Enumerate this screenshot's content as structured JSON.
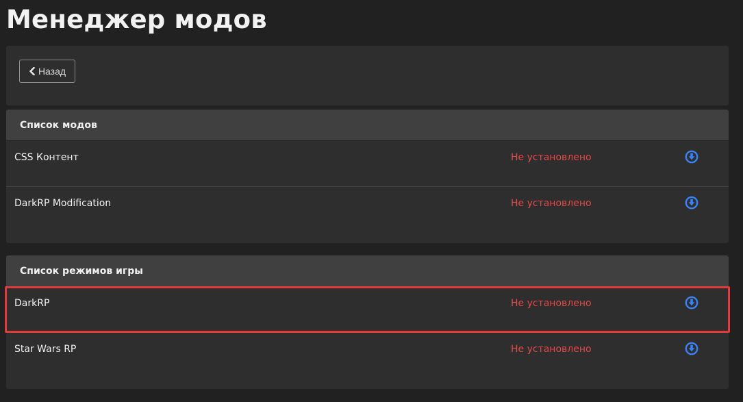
{
  "page": {
    "title": "Менеджер модов"
  },
  "toolbar": {
    "back_label": "Назад",
    "back_icon": "chevron-left-icon"
  },
  "colors": {
    "background": "#212121",
    "panel": "#2e2e2e",
    "panel_header": "#404040",
    "status_not_installed": "#e24a4a",
    "download_icon": "#3b82f6",
    "highlight": "#e03b3b"
  },
  "mods": {
    "header": "Список модов",
    "items": [
      {
        "name": "CSS Контент",
        "status": "Не установлено",
        "action_icon": "download-icon"
      },
      {
        "name": "DarkRP Modification",
        "status": "Не установлено",
        "action_icon": "download-icon"
      }
    ]
  },
  "gamemodes": {
    "header": "Список режимов игры",
    "items": [
      {
        "name": "DarkRP",
        "status": "Не установлено",
        "action_icon": "download-icon",
        "highlighted": true
      },
      {
        "name": "Star Wars RP",
        "status": "Не установлено",
        "action_icon": "download-icon"
      }
    ]
  }
}
